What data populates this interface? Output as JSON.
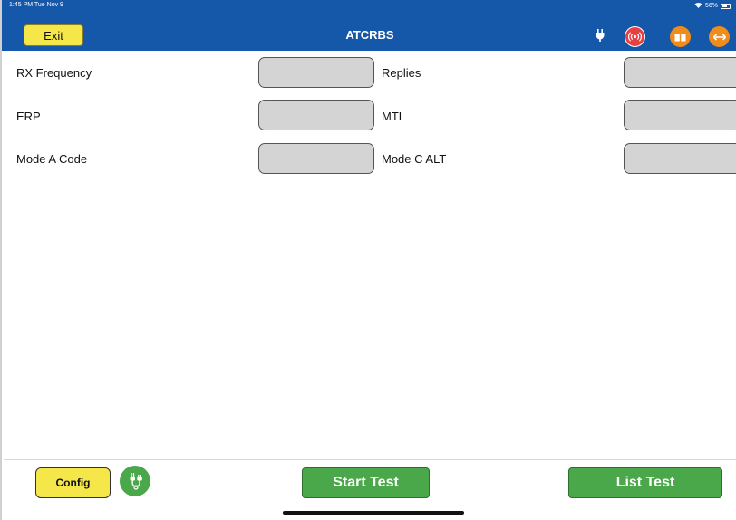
{
  "status_bar": {
    "time": "1:45 PM  Tue Nov 9",
    "battery": "56%"
  },
  "header": {
    "title": "ATCRBS",
    "exit_label": "Exit",
    "icons": [
      "plug-icon",
      "radio-signal-icon",
      "book-icon",
      "double-arrow-icon"
    ]
  },
  "fields": {
    "rx_frequency": {
      "label": "RX Frequency",
      "value": ""
    },
    "replies": {
      "label": "Replies",
      "value": ""
    },
    "erp": {
      "label": "ERP",
      "value": ""
    },
    "mtl": {
      "label": "MTL",
      "value": ""
    },
    "mode_a_code": {
      "label": "Mode A Code",
      "value": ""
    },
    "mode_c_alt": {
      "label": "Mode C ALT",
      "value": ""
    }
  },
  "footer": {
    "config_label": "Config",
    "start_test_label": "Start Test",
    "list_test_label": "List Test"
  },
  "colors": {
    "header_bg": "#1557a8",
    "yellow_button": "#f5e64a",
    "green_button": "#4aa84a",
    "field_bg": "#d4d4d4",
    "red_icon": "#e84040",
    "orange_icon": "#f08c1c"
  }
}
